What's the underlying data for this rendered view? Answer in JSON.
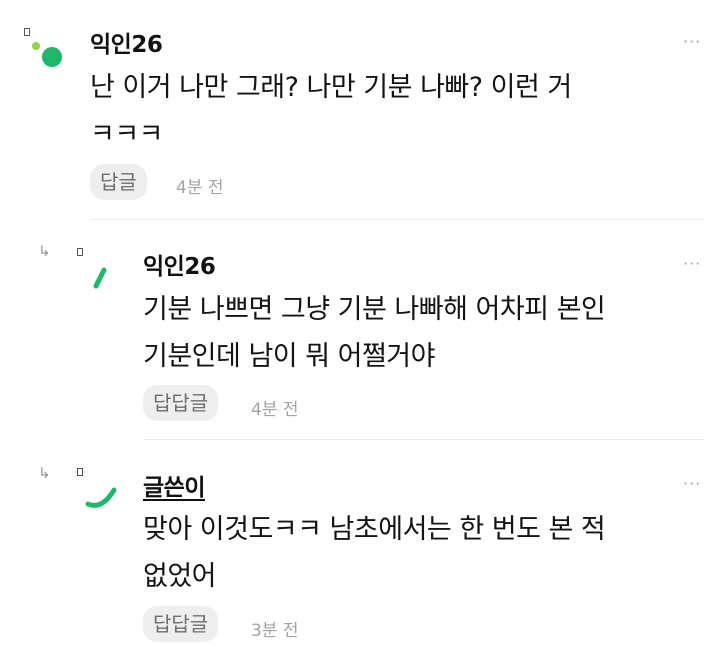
{
  "comments": [
    {
      "username": "익인26",
      "lines": [
        "난 이거 나만 그래? 나만 기분 나빠? 이런 거",
        "ㅋㅋㅋ"
      ],
      "reply_label": "답글",
      "time": "4분 전",
      "more": "···"
    },
    {
      "username": "익인26",
      "lines": [
        "기분 나쁘면 그냥 기분 나빠해 어차피 본인",
        "기분인데 남이 뭐 어쩔거야"
      ],
      "reply_label": "답답글",
      "time": "4분 전",
      "more": "···"
    },
    {
      "username": "글쓴이",
      "lines": [
        "맞아 이것도ㅋㅋ 남초에서는 한 번도 본 적",
        "없었어"
      ],
      "reply_label": "답답글",
      "time": "3분 전",
      "more": "···"
    }
  ],
  "reply_icon": "↳",
  "colors": {
    "accent_green": "#1fb86a",
    "light_green": "#8fd34a"
  }
}
